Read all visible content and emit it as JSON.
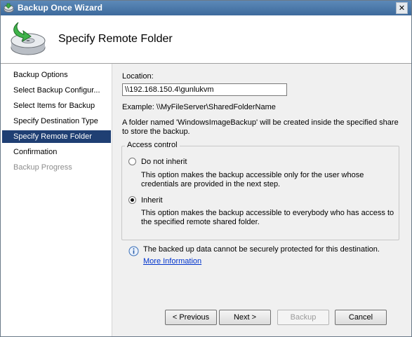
{
  "window": {
    "title": "Backup Once Wizard",
    "close_glyph": "✕"
  },
  "header": {
    "title": "Specify Remote Folder",
    "icon": "backup-disk-arrow-icon"
  },
  "sidebar": {
    "items": [
      {
        "label": "Backup Options",
        "state": "normal"
      },
      {
        "label": "Select Backup Configur...",
        "state": "normal"
      },
      {
        "label": "Select Items for Backup",
        "state": "normal"
      },
      {
        "label": "Specify Destination Type",
        "state": "normal"
      },
      {
        "label": "Specify Remote Folder",
        "state": "selected"
      },
      {
        "label": "Confirmation",
        "state": "normal"
      },
      {
        "label": "Backup Progress",
        "state": "disabled"
      }
    ]
  },
  "main": {
    "location_label": "Location:",
    "location_value": "\\\\192.168.150.4\\gunlukvm",
    "example": "Example: \\\\MyFileServer\\SharedFolderName",
    "folder_note_line1": "A folder named 'WindowsImageBackup' will be created inside the specified share",
    "folder_note_line2": "to store the backup.",
    "access_control": {
      "legend": "Access control",
      "options": [
        {
          "label": "Do not inherit",
          "selected": false,
          "desc_line1": "This option makes the backup accessible only for the user whose",
          "desc_line2": "credentials are provided in the next step."
        },
        {
          "label": "Inherit",
          "selected": true,
          "desc_line1": "This option makes the backup accessible to everybody who has access to",
          "desc_line2": "the specified remote shared folder."
        }
      ]
    },
    "info_text": "The backed up data cannot be securely protected for this destination.",
    "info_link": "More Information"
  },
  "buttons": {
    "previous": "< Previous",
    "next": "Next >",
    "backup": "Backup",
    "cancel": "Cancel"
  },
  "colors": {
    "titlebar": "#3d6a9c",
    "selected_nav": "#1f3f73",
    "content_bg": "#f0f0f0",
    "link": "#0033cc"
  }
}
